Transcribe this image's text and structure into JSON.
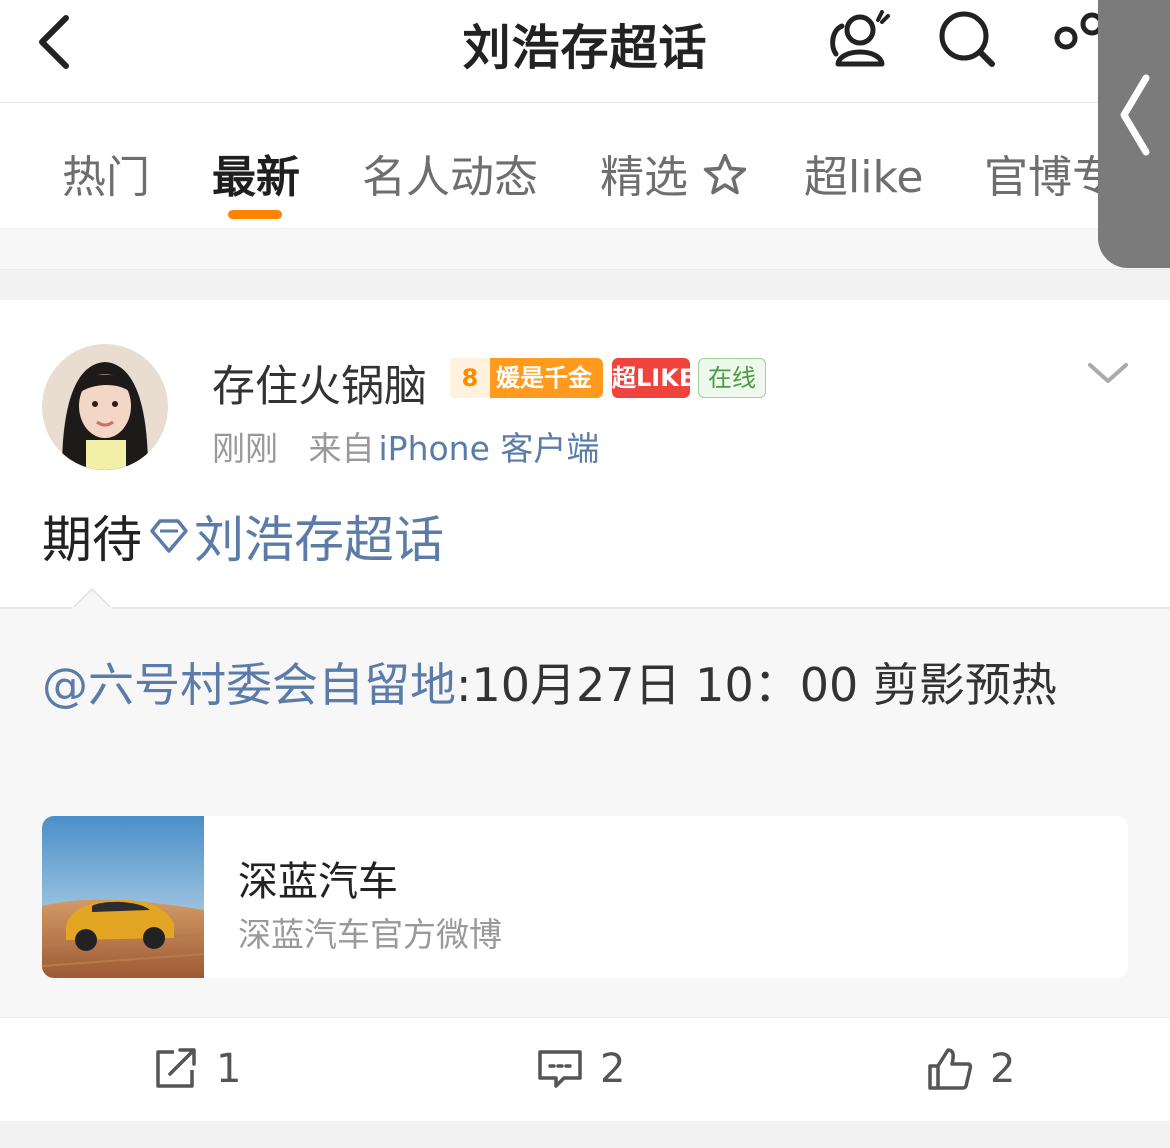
{
  "header": {
    "title": "刘浩存超话"
  },
  "tabs": [
    {
      "label": "热门"
    },
    {
      "label": "最新"
    },
    {
      "label": "名人动态"
    },
    {
      "label": "精选"
    },
    {
      "label": "超like"
    },
    {
      "label": "官博专"
    }
  ],
  "post": {
    "username": "存住火锅脑",
    "fan_badge": {
      "level": "8",
      "text": "媛是千金"
    },
    "superlike_badge": "超LIKE",
    "online_badge": "在线",
    "time": "刚刚",
    "source_prefix": "来自",
    "source": "iPhone 客户端",
    "text_prefix": "期待",
    "topic": "刘浩存超话",
    "repost": {
      "mention": "@六号村委会自留地",
      "text": ":10月27日 10：00 剪影预热"
    },
    "card": {
      "title": "深蓝汽车",
      "subtitle": "深蓝汽车官方微博"
    }
  },
  "actions": {
    "repost_count": "1",
    "comment_count": "2",
    "like_count": "2"
  },
  "colors": {
    "accent": "#ff8200",
    "link": "#5b7ca8",
    "superlike": "#f0433e",
    "online": "#4c9a45"
  }
}
